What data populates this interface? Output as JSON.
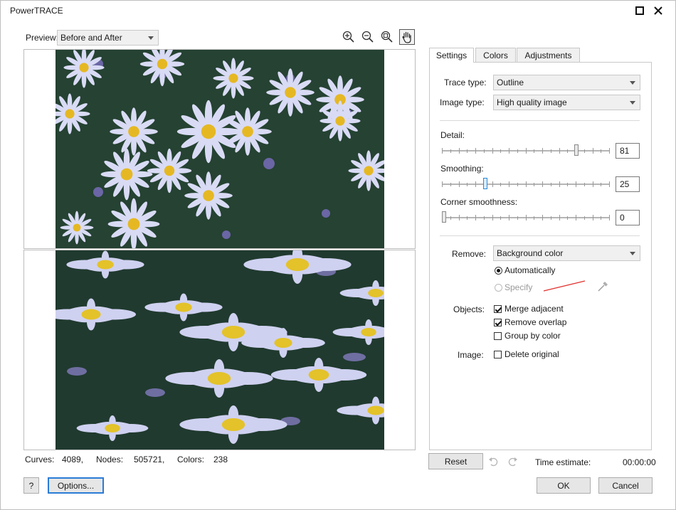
{
  "window": {
    "title": "PowerTRACE"
  },
  "preview": {
    "label": "Preview:",
    "value": "Before and After"
  },
  "tools": [
    "zoom-in-icon",
    "zoom-out-icon",
    "zoom-fit-icon",
    "pan-hand-icon"
  ],
  "status": {
    "curves_label": "Curves:",
    "curves_value": "4089,",
    "nodes_label": "Nodes:",
    "nodes_value": "505721,",
    "colors_label": "Colors:",
    "colors_value": "238"
  },
  "tabs": [
    {
      "label": "Settings",
      "active": true
    },
    {
      "label": "Colors",
      "active": false
    },
    {
      "label": "Adjustments",
      "active": false
    }
  ],
  "settings": {
    "trace_type_label": "Trace type:",
    "trace_type_value": "Outline",
    "image_type_label": "Image type:",
    "image_type_value": "High quality image",
    "detail_label": "Detail:",
    "detail_value": "81",
    "detail_level": 0.81,
    "smoothing_label": "Smoothing:",
    "smoothing_value": "25",
    "smoothing_level": 0.25,
    "corner_label": "Corner smoothness:",
    "corner_value": "0",
    "corner_level": 0,
    "remove_label": "Remove:",
    "remove_value": "Background color",
    "auto_label": "Automatically",
    "specify_label": "Specify",
    "objects_label": "Objects:",
    "merge_label": "Merge adjacent",
    "merge_checked": true,
    "overlap_label": "Remove overlap",
    "overlap_checked": true,
    "group_label": "Group by color",
    "group_checked": false,
    "image_label": "Image:",
    "delete_label": "Delete original",
    "delete_checked": false
  },
  "footer": {
    "reset_label": "Reset",
    "time_label": "Time estimate:",
    "time_value": "00:00:00",
    "help_label": "?",
    "options_label": "Options...",
    "ok_label": "OK",
    "cancel_label": "Cancel"
  },
  "colors": {
    "accent": "#2a7cd6",
    "specify_line": "#e0322e"
  }
}
